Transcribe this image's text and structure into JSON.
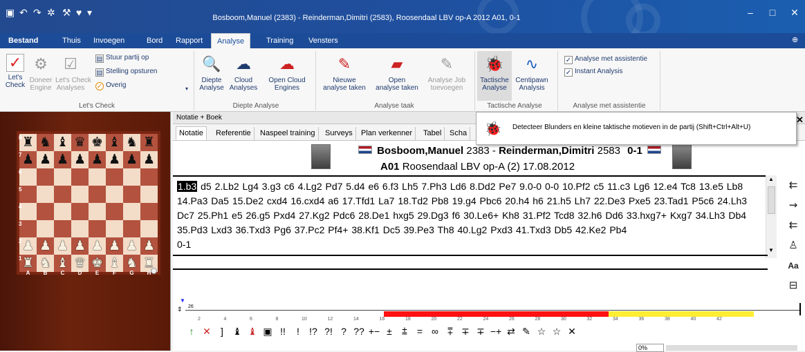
{
  "window": {
    "title": "Bosboom,Manuel (2383) - Reinderman,Dimitri (2583), Roosendaal LBV op-A 2012  A01, 0-1"
  },
  "menu_tabs": [
    "Bestand",
    "Thuis",
    "Invoegen",
    "Bord",
    "Rapport",
    "Analyse",
    "Training",
    "Vensters"
  ],
  "ribbon": {
    "letscheck": {
      "check": "Let's\nCheck",
      "engine": "Doneer\nEngine",
      "analyses": "Let's Check\nAnalyses",
      "stuur": "Stuur partij op",
      "stelling": "Stelling opsturen",
      "overig": "Overig",
      "group": "Let's Check"
    },
    "diepte": {
      "diepte_btn": "Diepte\nAnalyse",
      "cloud_btn": "Cloud\nAnalyses",
      "open_cloud": "Open Cloud\nEngines",
      "group": "Diepte Analyse"
    },
    "taak": {
      "nieuwe": "Nieuwe\nanalyse taken",
      "open": "Open\nanalyse taken",
      "job": "Analyse Job\ntoevoegen",
      "group": "Analyse taak"
    },
    "tactische": {
      "tact": "Tactische\nAnalyse",
      "centi": "Centipawn\nAnalysis",
      "group": "Tactische Analyse"
    },
    "assist": {
      "met": "Analyse met assistentie",
      "instant": "Instant Analysis",
      "group": "Analyse met assistentie"
    }
  },
  "board": {
    "ranks": [
      "8",
      "7",
      "6",
      "5",
      "4",
      "3",
      "2",
      "1"
    ],
    "files": [
      "A",
      "B",
      "C",
      "D",
      "E",
      "F",
      "G",
      "H"
    ]
  },
  "panel_title": "Notatie + Boek",
  "notation_tabs": [
    "Notatie",
    "Referentie",
    "Naspeel training",
    "Surveys",
    "Plan verkenner",
    "Tabel",
    "Scha"
  ],
  "game": {
    "white": "Bosboom,Manuel",
    "white_elo": "2383",
    "black": "Reinderman,Dimitri",
    "black_elo": "2583",
    "result": "0-1",
    "eco": "A01",
    "event": "Roosendaal LBV op-A (2) 17.08.2012"
  },
  "moves": {
    "first": "1.b3",
    "rest": " d5 2.Lb2 Lg4 3.g3 c6 4.Lg2 Pd7 5.d4 e6 6.f3 Lh5 7.Ph3 Ld6 8.Dd2 Pe7 9.0-0 0-0 10.Pf2 c5 11.c3 Lg6 12.e4 Tc8 13.e5 Lb8 14.Pa3 Da5 15.De2 cxd4 16.cxd4 a6 17.Tfd1 La7 18.Td2 Pb8 19.g4 Pbc6 20.h4 h6 21.h5 Lh7 22.De3 Pxe5 23.Tad1 P5c6 24.Lh3 Dc7 25.Ph1 e5 26.g5 Pxd4 27.Kg2 Pdc6 28.De1 hxg5 29.Dg3 f6 30.Le6+ Kh8 31.Pf2 Tcd8 32.h6 Dd6 33.hxg7+ Kxg7 34.Lh3 Db4 35.Pd3 Lxd3 36.Txd3 Pg6 37.Pc2 Pf4+ 38.Kf1 Dc5 39.Pe3 Th8 40.Lg2 Pxd3 41.Txd3 Db5 42.Ke2 Pb4",
    "result": "0-1"
  },
  "eval_top": "26",
  "eval_ticks": [
    "2",
    "4",
    "6",
    "8",
    "10",
    "12",
    "14",
    "16",
    "18",
    "20",
    "22",
    "24",
    "26",
    "28",
    "30",
    "32",
    "34",
    "36",
    "38",
    "40",
    "42"
  ],
  "symbols": [
    "↑",
    "✕",
    "]",
    "♝",
    "♝",
    "▣",
    "!!",
    "!",
    "!?",
    "?!",
    "?",
    "??",
    "+−",
    "±",
    "⩲",
    "=",
    "∞",
    "⩱",
    "∓",
    "∓",
    "−+",
    "⇄",
    "✎",
    "☆",
    "☆",
    "✕"
  ],
  "tooltip": "Detecteer Blunders en kleine taktische motieven in de partij (Shift+Ctrl+Alt+U)",
  "status": "0%",
  "side_tools": [
    "⇇",
    "⇝",
    "⇇",
    "♙",
    "Aa",
    "⊟"
  ]
}
